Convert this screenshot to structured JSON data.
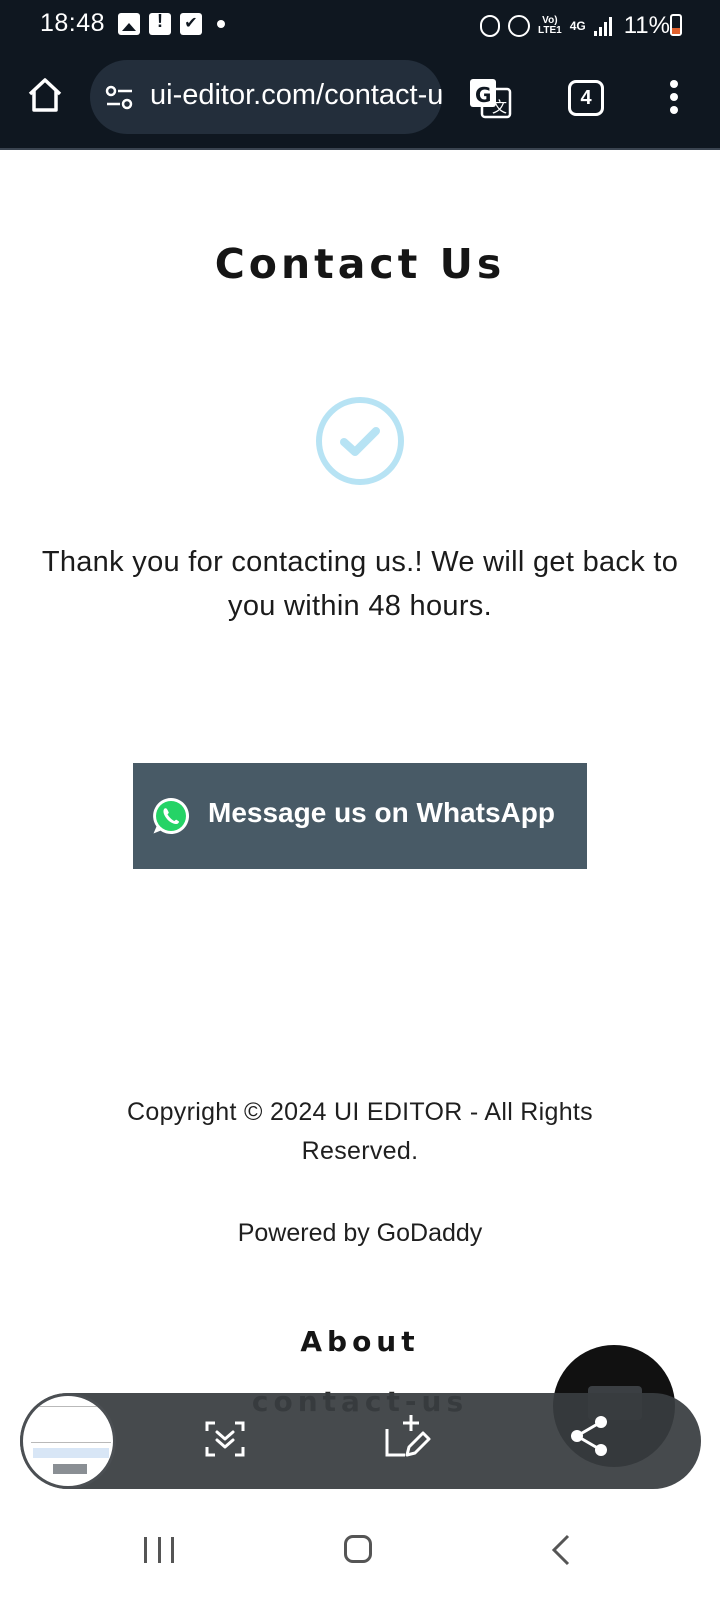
{
  "status_bar": {
    "time": "18:48",
    "network_line1": "Vo)",
    "network_line2": "LTE1",
    "network_type": "4G",
    "battery": "11%",
    "icons": [
      "image-icon",
      "alert-icon",
      "checkbox-icon",
      "dot-icon",
      "battery-saver-icon",
      "alarm-icon",
      "signal-icon",
      "battery-icon"
    ]
  },
  "browser": {
    "url": "ui-editor.com/contact-us",
    "tab_count": "4",
    "icons": [
      "home-icon",
      "site-settings-icon",
      "translate-icon",
      "tabs-icon",
      "more-vert-icon"
    ]
  },
  "page": {
    "title": "Contact Us",
    "thanks": "Thank you for contacting us.! We will get back to you within 48 hours.",
    "whatsapp_button": "Message us on WhatsApp",
    "copyright": "Copyright © 2024 UI EDITOR - All Rights Reserved.",
    "powered_by": "Powered by GoDaddy",
    "footer_links": [
      "About",
      "contact-us"
    ]
  },
  "colors": {
    "check_circle": "#b7e3f4",
    "whatsapp_button_bg": "#485a66",
    "whatsapp_green": "#25d366",
    "browser_bg": "#0f1720"
  }
}
